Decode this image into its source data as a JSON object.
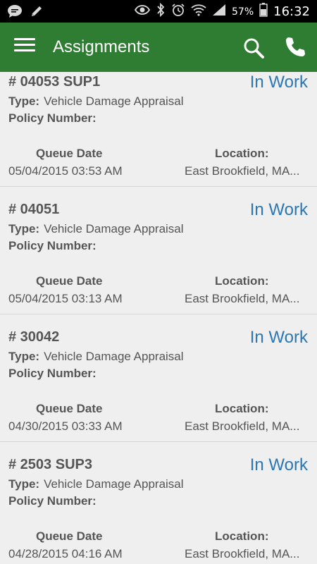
{
  "status_bar": {
    "left_icons": [
      "chat-icon",
      "edit-icon"
    ],
    "right_icons": [
      "eye-icon",
      "bluetooth-icon",
      "alarm-icon",
      "wifi-icon",
      "signal-icon",
      "battery-icon"
    ],
    "battery_percent": "57%",
    "time": "16:32"
  },
  "app_bar": {
    "title": "Assignments",
    "color": "#2e7d32",
    "icons": [
      "menu-icon",
      "search-icon",
      "phone-icon"
    ]
  },
  "labels": {
    "type": "Type:",
    "policy_number": "Policy Number:",
    "queue_date": "Queue Date",
    "location": "Location:"
  },
  "assignments": [
    {
      "number": "# 04053 SUP1",
      "status": "In Work",
      "type": "Vehicle Damage Appraisal",
      "queue_date": "05/04/2015 03:53 AM",
      "location": "East Brookfield, MA..."
    },
    {
      "number": "# 04051",
      "status": "In Work",
      "type": "Vehicle Damage Appraisal",
      "queue_date": "05/04/2015 03:13 AM",
      "location": "East Brookfield, MA..."
    },
    {
      "number": "# 30042",
      "status": "In Work",
      "type": "Vehicle Damage Appraisal",
      "queue_date": "04/30/2015 03:33 AM",
      "location": "East Brookfield, MA..."
    },
    {
      "number": "# 2503 SUP3",
      "status": "In Work",
      "type": "Vehicle Damage Appraisal",
      "queue_date": "04/28/2015 04:16 AM",
      "location": "East Brookfield, MA..."
    }
  ],
  "colors": {
    "status_text": "#2a77b4",
    "background": "#efefef"
  }
}
